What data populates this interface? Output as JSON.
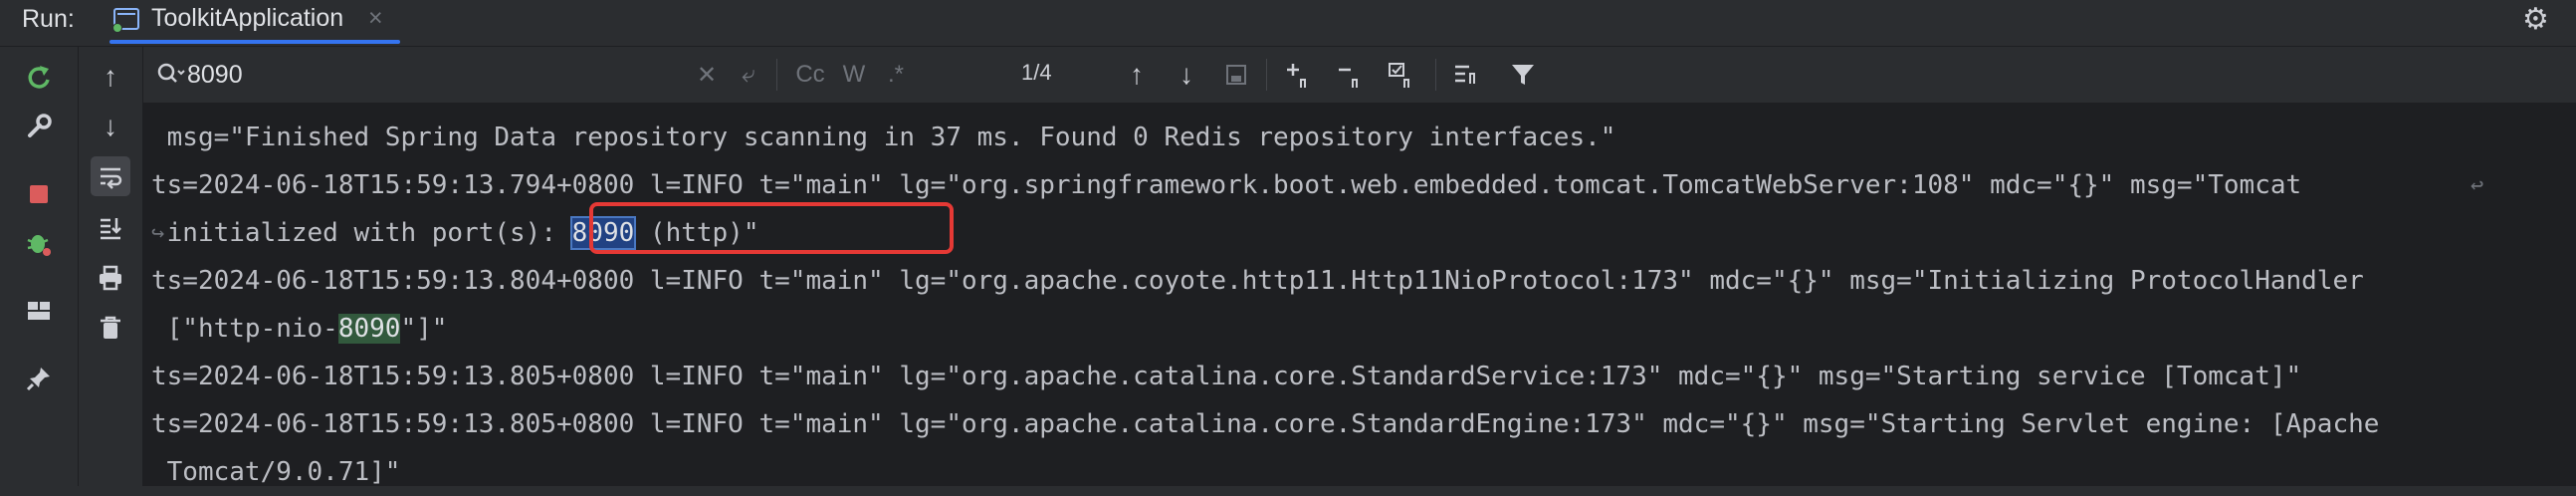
{
  "header": {
    "run_label": "Run:",
    "tab_label": "ToolkitApplication",
    "tab_close": "×"
  },
  "search": {
    "query": "8090",
    "match_count": "1/4",
    "case_label": "Cc",
    "words_label": "W",
    "regex_label": ".*"
  },
  "console": {
    "line1": " msg=\"Finished Spring Data repository scanning in 37 ms. Found 0 Redis repository interfaces.\"",
    "line2": "ts=2024-06-18T15:59:13.794+0800 l=INFO t=\"main\" lg=\"org.springframework.boot.web.embedded.tomcat.TomcatWebServer:108\" mdc=\"{}\" msg=\"Tomcat",
    "line3_pre": " initialized with port(s): ",
    "line3_match": "8090",
    "line3_post": " (http)\"",
    "line4": "ts=2024-06-18T15:59:13.804+0800 l=INFO t=\"main\" lg=\"org.apache.coyote.http11.Http11NioProtocol:173\" mdc=\"{}\" msg=\"Initializing ProtocolHandler",
    "line5_pre": " [\"http-nio-",
    "line5_match": "8090",
    "line5_post": "\"]\"",
    "line6": "ts=2024-06-18T15:59:13.805+0800 l=INFO t=\"main\" lg=\"org.apache.catalina.core.StandardService:173\" mdc=\"{}\" msg=\"Starting service [Tomcat]\"",
    "line7": "ts=2024-06-18T15:59:13.805+0800 l=INFO t=\"main\" lg=\"org.apache.catalina.core.StandardEngine:173\" mdc=\"{}\" msg=\"Starting Servlet engine: [Apache",
    "line8": " Tomcat/9.0.71]\""
  },
  "colors": {
    "background": "#1e1f22",
    "toolbar": "#2b2d30",
    "selected_match": "#214283",
    "other_match": "#32593d",
    "annotation_box": "#e53935",
    "tab_underline": "#3574f0"
  }
}
